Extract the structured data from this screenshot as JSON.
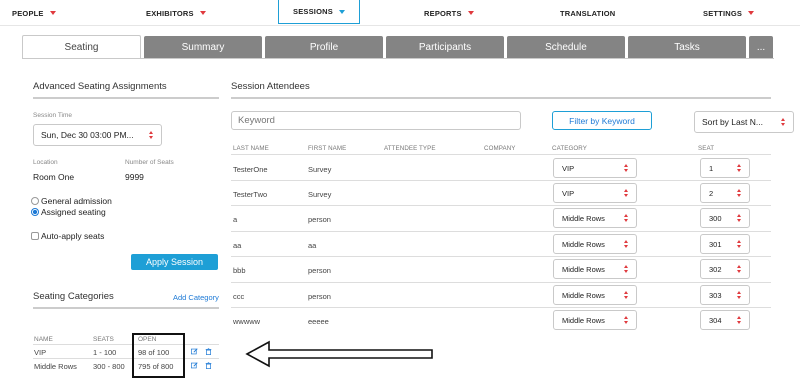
{
  "nav": {
    "items": [
      {
        "label": "PEOPLE"
      },
      {
        "label": "EXHIBITORS"
      },
      {
        "label": "SESSIONS"
      },
      {
        "label": "REPORTS"
      },
      {
        "label": "TRANSLATION"
      },
      {
        "label": "SETTINGS"
      }
    ],
    "active": "SESSIONS"
  },
  "tabs": [
    "Seating",
    "Summary",
    "Profile",
    "Participants",
    "Schedule",
    "Tasks",
    "..."
  ],
  "active_tab": "Seating",
  "left": {
    "title": "Advanced Seating Assignments",
    "session_time_label": "Session Time",
    "session_time_value": "Sun, Dec 30 03:00 PM...",
    "location_label": "Location",
    "location_value": "Room One",
    "seats_label": "Number of Seats",
    "seats_value": "9999",
    "radio_general": "General admission",
    "radio_assigned": "Assigned seating",
    "checkbox_auto": "Auto-apply seats",
    "apply_button": "Apply Session",
    "categories_title": "Seating Categories",
    "add_category": "Add Category",
    "cat_headers": [
      "NAME",
      "SEATS",
      "OPEN"
    ],
    "categories": [
      {
        "name": "VIP",
        "seats": "1 - 100",
        "open": "98 of 100"
      },
      {
        "name": "Middle Rows",
        "seats": "300 - 800",
        "open": "795 of 800"
      }
    ]
  },
  "right": {
    "title": "Session Attendees",
    "keyword_placeholder": "Keyword",
    "filter_button": "Filter by Keyword",
    "sort_select": "Sort by Last N...",
    "headers": [
      "LAST NAME",
      "FIRST NAME",
      "ATTENDEE TYPE",
      "COMPANY",
      "CATEGORY",
      "SEAT"
    ],
    "rows": [
      {
        "last": "TesterOne",
        "first": "Survey",
        "type": "",
        "company": "",
        "category": "VIP",
        "seat": "1"
      },
      {
        "last": "TesterTwo",
        "first": "Survey",
        "type": "",
        "company": "",
        "category": "VIP",
        "seat": "2"
      },
      {
        "last": "a",
        "first": "person",
        "type": "",
        "company": "",
        "category": "Middle Rows",
        "seat": "300"
      },
      {
        "last": "aa",
        "first": "aa",
        "type": "",
        "company": "",
        "category": "Middle Rows",
        "seat": "301"
      },
      {
        "last": "bbb",
        "first": "person",
        "type": "",
        "company": "",
        "category": "Middle Rows",
        "seat": "302"
      },
      {
        "last": "ccc",
        "first": "person",
        "type": "",
        "company": "",
        "category": "Middle Rows",
        "seat": "303"
      },
      {
        "last": "wwwww",
        "first": "eeeee",
        "type": "",
        "company": "",
        "category": "Middle Rows",
        "seat": "304"
      }
    ]
  },
  "colors": {
    "accent": "#1e9fd6",
    "caret": "#e0393e",
    "tab_inactive": "#848484",
    "highlight_box": "#111111"
  },
  "annotation": {
    "icon": "left-arrow-outline-icon"
  }
}
